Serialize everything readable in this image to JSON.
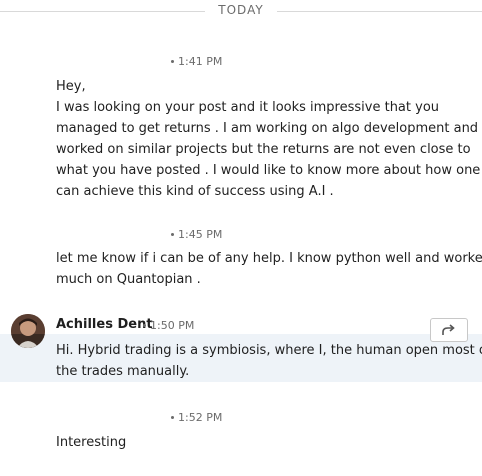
{
  "divider": {
    "label": "TODAY"
  },
  "messages": [
    {
      "time": "1:41 PM",
      "lines": [
        "Hey,",
        "I was looking on your post and it looks impressive that you",
        "managed to get returns . I am working on algo development and",
        "worked on similar projects but the returns are not even close to",
        "what you have posted . I would like to know more about how one",
        "can achieve this kind of success using A.I ."
      ]
    },
    {
      "time": "1:45 PM",
      "lines": [
        "let me know if i can be of any help. I know python well and worked",
        "much on Quantopian ."
      ]
    },
    {
      "sender": "Achilles Dent",
      "time": "1:50 PM",
      "lines": [
        "Hi. Hybrid trading is a symbiosis, where I, the human open most of",
        "the trades manually."
      ]
    },
    {
      "time": "1:52 PM",
      "lines": [
        "Interesting"
      ]
    }
  ],
  "icons": {
    "share": "share-arrow-icon",
    "avatar": "user-avatar"
  },
  "colors": {
    "highlight_bg": "#eef3f8",
    "text": "#1f1f1f",
    "muted": "#6b6b6b"
  }
}
